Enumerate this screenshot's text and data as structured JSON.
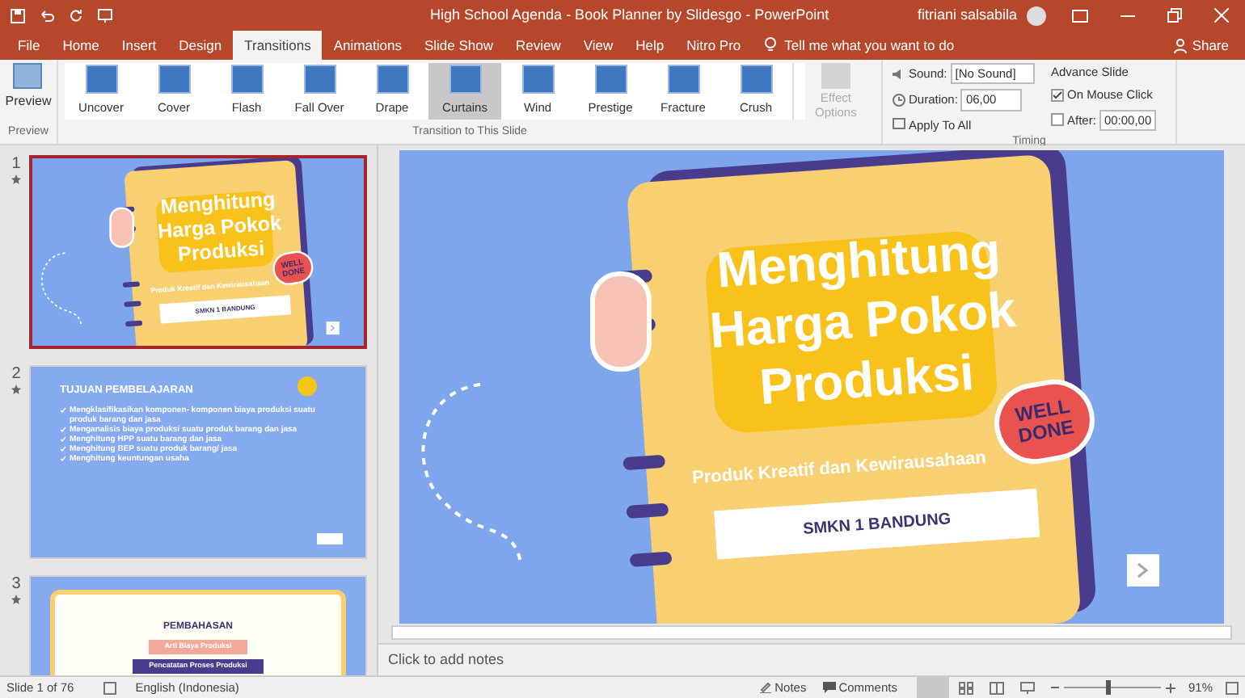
{
  "window": {
    "title": "High School Agenda - Book Planner by Slidesgo  -  PowerPoint",
    "user": "fitriani salsabila"
  },
  "tabs": [
    {
      "label": "File",
      "selected": false
    },
    {
      "label": "Home",
      "selected": false
    },
    {
      "label": "Insert",
      "selected": false
    },
    {
      "label": "Design",
      "selected": false
    },
    {
      "label": "Transitions",
      "selected": true
    },
    {
      "label": "Animations",
      "selected": false
    },
    {
      "label": "Slide Show",
      "selected": false
    },
    {
      "label": "Review",
      "selected": false
    },
    {
      "label": "View",
      "selected": false
    },
    {
      "label": "Help",
      "selected": false
    },
    {
      "label": "Nitro Pro",
      "selected": false
    }
  ],
  "tell_me": "Tell me what you want to do",
  "share": "Share",
  "ribbon": {
    "preview": {
      "button": "Preview",
      "group": "Preview"
    },
    "transitions": [
      {
        "label": "Uncover",
        "selected": false
      },
      {
        "label": "Cover",
        "selected": false
      },
      {
        "label": "Flash",
        "selected": false
      },
      {
        "label": "Fall Over",
        "selected": false
      },
      {
        "label": "Drape",
        "selected": false
      },
      {
        "label": "Curtains",
        "selected": true
      },
      {
        "label": "Wind",
        "selected": false
      },
      {
        "label": "Prestige",
        "selected": false
      },
      {
        "label": "Fracture",
        "selected": false
      },
      {
        "label": "Crush",
        "selected": false
      }
    ],
    "effect_options": {
      "lines": [
        "Effect",
        "Options"
      ],
      "disabled": true
    },
    "transitions_group": "Transition to This Slide",
    "timing": {
      "sound_label": "Sound:",
      "sound_value": "[No Sound]",
      "duration_label": "Duration:",
      "duration_value": "06,00",
      "apply_all": "Apply To All",
      "advance_title": "Advance Slide",
      "on_click": {
        "label": "On Mouse Click",
        "checked": true
      },
      "after": {
        "label": "After:",
        "checked": false,
        "value": "00:00,00"
      },
      "group": "Timing"
    }
  },
  "slides": [
    {
      "number": "1",
      "selected": true,
      "kind": "title",
      "title_lines": [
        "Menghitung",
        "Harga Pokok",
        "Produksi"
      ],
      "subtitle": "Produk Kreatif dan Kewirausahaan",
      "badge_lines": [
        "WELL",
        "DONE"
      ],
      "school": "SMKN 1 BANDUNG"
    },
    {
      "number": "2",
      "selected": false,
      "kind": "objectives",
      "heading": "TUJUAN PEMBELAJARAN",
      "bullets": [
        "Mengklasifikasikan komponen- komponen biaya produksi suatu produk barang dan jasa",
        "Menganalisis biaya produksi suatu produk barang dan jasa",
        "Menghitung HPP suatu barang dan jasa",
        "Menghitung BEP suatu produk barang/ jasa",
        "Menghitung keuntungan usaha"
      ]
    },
    {
      "number": "3",
      "selected": false,
      "kind": "agenda",
      "heading": "PEMBAHASAN",
      "items": [
        "Arti Biaya Produksi",
        "Pencatatan Proses Produksi"
      ]
    }
  ],
  "main_slide": {
    "title_lines": [
      "Menghitung",
      "Harga Pokok",
      "Produksi"
    ],
    "subtitle": "Produk Kreatif dan Kewirausahaan",
    "badge_lines": [
      "WELL",
      "DONE"
    ],
    "school": "SMKN 1 BANDUNG"
  },
  "notes_placeholder": "Click to add notes",
  "status_bar": {
    "slide_counter": "Slide 1 of 76",
    "language": "English (Indonesia)",
    "notes": "Notes",
    "comments": "Comments",
    "zoom": "91%",
    "zoom_slider": {
      "level": 0.45
    }
  }
}
